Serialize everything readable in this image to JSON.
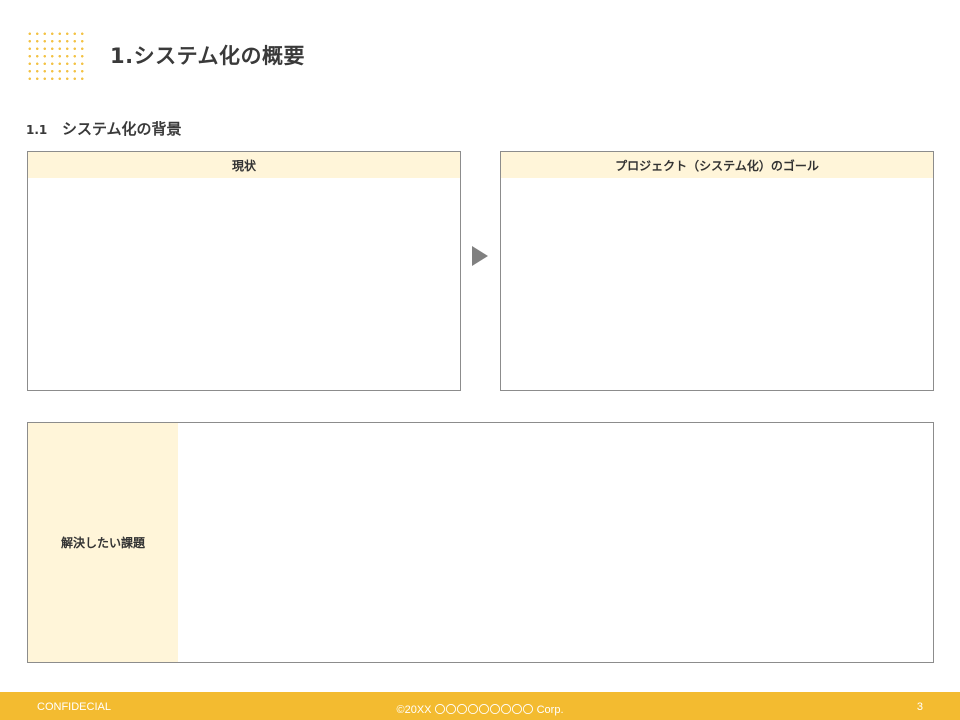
{
  "slide": {
    "title": "1.システム化の概要"
  },
  "section": {
    "number": "1.1",
    "title": "システム化の背景"
  },
  "panels": {
    "current_label": "現状",
    "goal_label": "プロジェクト（システム化）のゴール",
    "issues_label": "解決したい課題"
  },
  "footer": {
    "left": "CONFIDECIAL",
    "center": "©20XX 〇〇〇〇〇〇〇〇〇 Corp.",
    "page_number": "3"
  },
  "colors": {
    "accent": "#f3bb30",
    "header_fill": "#fff5d9",
    "border": "#8c8c8c",
    "arrow": "#808080"
  }
}
